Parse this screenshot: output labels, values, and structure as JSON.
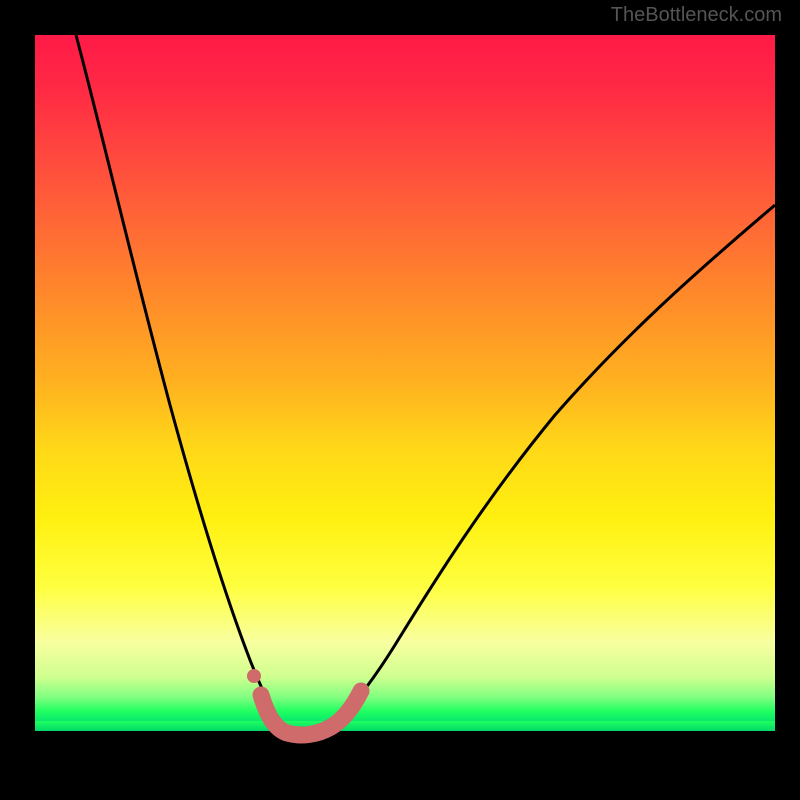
{
  "watermark": "TheBottleneck.com",
  "chart_data": {
    "type": "line",
    "title": "",
    "xlabel": "",
    "ylabel": "",
    "x_range": [
      0,
      1
    ],
    "y_range": [
      0,
      1
    ],
    "curve_description": "V-shaped bottleneck curve on rainbow gradient; left branch steep descent, right branch shallower rise",
    "series": [
      {
        "name": "main-curve",
        "color": "#000000",
        "x": [
          0.055,
          0.1,
          0.14,
          0.18,
          0.22,
          0.26,
          0.285,
          0.305,
          0.32,
          0.335,
          0.355,
          0.38,
          0.405,
          0.43,
          0.46,
          0.52,
          0.6,
          0.7,
          0.82,
          0.94,
          1.0
        ],
        "y": [
          1.0,
          0.83,
          0.68,
          0.53,
          0.38,
          0.23,
          0.13,
          0.06,
          0.02,
          0.0,
          0.0,
          0.0,
          0.02,
          0.06,
          0.12,
          0.23,
          0.37,
          0.51,
          0.64,
          0.74,
          0.78
        ]
      },
      {
        "name": "bottom-highlight",
        "color": "#d16868",
        "type": "marker-band",
        "x": [
          0.295,
          0.31,
          0.325,
          0.34,
          0.355,
          0.37,
          0.385,
          0.4,
          0.415,
          0.43
        ],
        "y": [
          0.055,
          0.02,
          0.005,
          0.0,
          0.0,
          0.0,
          0.005,
          0.015,
          0.03,
          0.055
        ]
      }
    ],
    "gradient_stops": [
      {
        "pos": 0.0,
        "color": "#ff1a47"
      },
      {
        "pos": 0.5,
        "color": "#ffb020"
      },
      {
        "pos": 0.8,
        "color": "#ffff40"
      },
      {
        "pos": 1.0,
        "color": "#00e070"
      }
    ]
  }
}
